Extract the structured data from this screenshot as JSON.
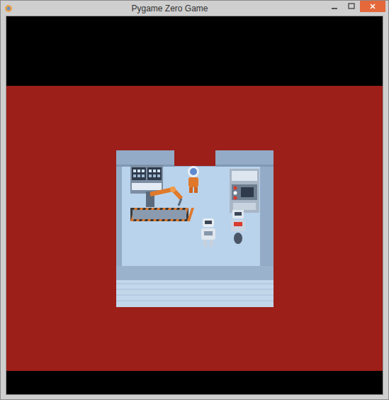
{
  "window": {
    "title": "Pygame Zero Game"
  }
}
